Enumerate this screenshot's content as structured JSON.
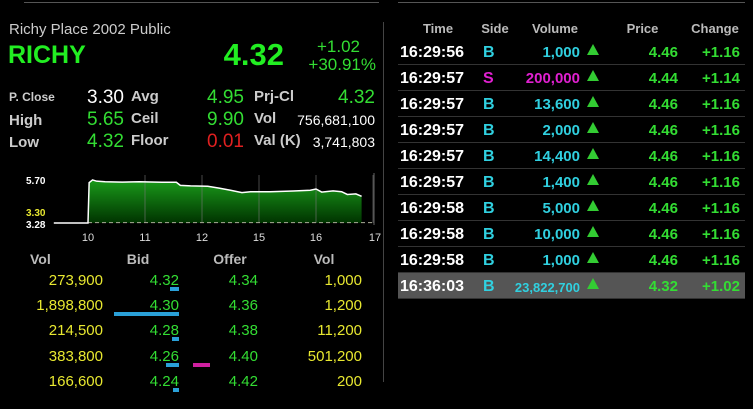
{
  "stock": {
    "company": "Richy Place 2002 Public",
    "symbol": "RICHY",
    "last": "4.32",
    "change": "+1.02",
    "change_pct": "+30.91%"
  },
  "stats": [
    [
      {
        "label": "P. Close",
        "value": "3.30",
        "color": "w"
      },
      {
        "label": "Avg",
        "value": "4.95",
        "color": "g"
      },
      {
        "label": "Prj-Cl",
        "value": "4.32",
        "color": "g"
      }
    ],
    [
      {
        "label": "High",
        "value": "5.65",
        "color": "g"
      },
      {
        "label": "Ceil",
        "value": "9.90",
        "color": "g"
      },
      {
        "label": "Vol",
        "value": "756,681,100",
        "color": "w"
      }
    ],
    [
      {
        "label": "Low",
        "value": "4.32",
        "color": "g"
      },
      {
        "label": "Floor",
        "value": "0.01",
        "color": "r"
      },
      {
        "label": "Val (K)",
        "value": "3,741,803",
        "color": "w"
      }
    ]
  ],
  "chart_data": {
    "type": "area",
    "y_labels": [
      {
        "text": "5.70",
        "value": 5.7,
        "color": "#ffffff"
      },
      {
        "text": "3.30",
        "value": 3.3,
        "color": "#e8e830"
      },
      {
        "text": "3.28",
        "value": 3.28,
        "color": "#ffffff"
      }
    ],
    "x_labels": [
      "10",
      "11",
      "12",
      "15",
      "16",
      "17"
    ],
    "ylim": [
      3.28,
      5.7
    ],
    "points": [
      [
        -0.6,
        3.28
      ],
      [
        0,
        3.28
      ],
      [
        0.02,
        5.5
      ],
      [
        0.08,
        5.65
      ],
      [
        0.15,
        5.58
      ],
      [
        0.3,
        5.55
      ],
      [
        0.6,
        5.53
      ],
      [
        0.9,
        5.55
      ],
      [
        1.3,
        5.52
      ],
      [
        1.55,
        5.52
      ],
      [
        1.62,
        5.35
      ],
      [
        1.8,
        5.32
      ],
      [
        2.1,
        5.3
      ],
      [
        2.3,
        5.2
      ],
      [
        2.5,
        5.08
      ],
      [
        2.7,
        4.95
      ],
      [
        2.85,
        5.0
      ],
      [
        3.2,
        5.0
      ],
      [
        3.6,
        5.04
      ],
      [
        3.9,
        5.08
      ],
      [
        4.0,
        5.15
      ],
      [
        4.1,
        4.98
      ],
      [
        4.3,
        5.05
      ],
      [
        4.45,
        5.0
      ],
      [
        4.55,
        4.85
      ],
      [
        4.7,
        4.88
      ],
      [
        4.8,
        4.75
      ]
    ]
  },
  "orderbook": {
    "headers": [
      "Vol",
      "Bid",
      "Offer",
      "Vol"
    ],
    "rows": [
      {
        "bid_vol": "273,900",
        "bid": "4.32",
        "offer": "4.34",
        "offer_vol": "1,000",
        "bv": 273900,
        "ov": 1000
      },
      {
        "bid_vol": "1,898,800",
        "bid": "4.30",
        "offer": "4.36",
        "offer_vol": "1,200",
        "bv": 1898800,
        "ov": 1200
      },
      {
        "bid_vol": "214,500",
        "bid": "4.28",
        "offer": "4.38",
        "offer_vol": "11,200",
        "bv": 214500,
        "ov": 11200
      },
      {
        "bid_vol": "383,800",
        "bid": "4.26",
        "offer": "4.40",
        "offer_vol": "501,200",
        "bv": 383800,
        "ov": 501200
      },
      {
        "bid_vol": "166,600",
        "bid": "4.24",
        "offer": "4.42",
        "offer_vol": "200",
        "bv": 166600,
        "ov": 200
      }
    ]
  },
  "ticks": {
    "headers": [
      "Time",
      "Side",
      "Volume",
      "Price",
      "Change"
    ],
    "rows": [
      {
        "time": "16:29:56",
        "side": "B",
        "volume": "1,000",
        "price": "4.46",
        "change": "+1.16"
      },
      {
        "time": "16:29:57",
        "side": "S",
        "volume": "200,000",
        "price": "4.44",
        "change": "+1.14"
      },
      {
        "time": "16:29:57",
        "side": "B",
        "volume": "13,600",
        "price": "4.46",
        "change": "+1.16"
      },
      {
        "time": "16:29:57",
        "side": "B",
        "volume": "2,000",
        "price": "4.46",
        "change": "+1.16"
      },
      {
        "time": "16:29:57",
        "side": "B",
        "volume": "14,400",
        "price": "4.46",
        "change": "+1.16"
      },
      {
        "time": "16:29:57",
        "side": "B",
        "volume": "1,400",
        "price": "4.46",
        "change": "+1.16"
      },
      {
        "time": "16:29:58",
        "side": "B",
        "volume": "5,000",
        "price": "4.46",
        "change": "+1.16"
      },
      {
        "time": "16:29:58",
        "side": "B",
        "volume": "10,000",
        "price": "4.46",
        "change": "+1.16"
      },
      {
        "time": "16:29:58",
        "side": "B",
        "volume": "1,000",
        "price": "4.46",
        "change": "+1.16"
      },
      {
        "time": "16:36:03",
        "side": "B",
        "volume": "23,822,700",
        "price": "4.32",
        "change": "+1.02",
        "highlight": true
      }
    ]
  }
}
